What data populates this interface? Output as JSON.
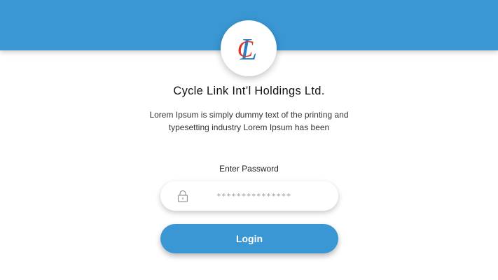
{
  "header": {
    "brand_color": "#3a97d4"
  },
  "logo": {
    "icon": "cl-monogram-logo",
    "letter_c": "C",
    "letter_l": "L",
    "c_color": "#d9382a",
    "l_color": "#2a7fc4"
  },
  "company": {
    "name": "Cycle Link Int’l Holdings Ltd.",
    "description": "Lorem Ipsum is simply dummy text of the printing and typesetting industry Lorem Ipsum has been"
  },
  "form": {
    "password_label": "Enter Password",
    "password_placeholder": "***************",
    "password_icon": "lock-icon",
    "login_label": "Login"
  }
}
